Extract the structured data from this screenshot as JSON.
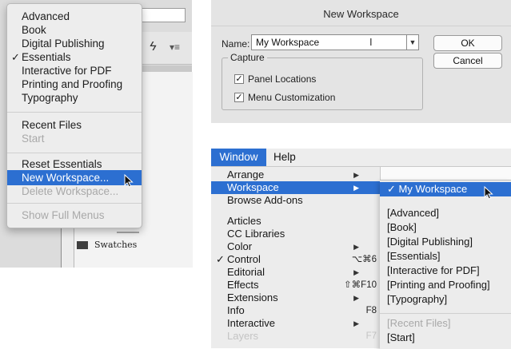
{
  "workspace_menu": {
    "items": [
      {
        "label": "Advanced"
      },
      {
        "label": "Book"
      },
      {
        "label": "Digital Publishing"
      },
      {
        "label": "Essentials",
        "checked": true
      },
      {
        "label": "Interactive for PDF"
      },
      {
        "label": "Printing and Proofing"
      },
      {
        "label": "Typography"
      }
    ],
    "recent": {
      "label": "Recent Files"
    },
    "start": {
      "label": "Start",
      "disabled": true
    },
    "reset": {
      "label": "Reset Essentials"
    },
    "new_workspace": {
      "label": "New Workspace...",
      "highlighted": true
    },
    "delete_workspace": {
      "label": "Delete Workspace...",
      "disabled": true
    },
    "show_full_menus": {
      "label": "Show Full Menus",
      "disabled": true
    },
    "check_mark": "✓",
    "panel_label": "Swatches"
  },
  "dialog": {
    "title": "New Workspace",
    "name_label": "Name:",
    "name_value": "My Workspace",
    "capture_label": "Capture",
    "panel_locations": {
      "label": "Panel Locations",
      "checked": true
    },
    "menu_customization": {
      "label": "Menu Customization",
      "checked": true
    },
    "ok": "OK",
    "cancel": "Cancel"
  },
  "window_menu": {
    "menubar": {
      "window": "Window",
      "help": "Help"
    },
    "items": [
      {
        "label": "Arrange",
        "submenu": true
      },
      {
        "label": "Workspace",
        "submenu": true,
        "highlighted": true
      },
      {
        "label": "Browse Add-ons"
      },
      {
        "label": "Articles"
      },
      {
        "label": "CC Libraries"
      },
      {
        "label": "Color",
        "submenu": true
      },
      {
        "label": "Control",
        "checked": true,
        "shortcut": "⌥⌘6"
      },
      {
        "label": "Editorial",
        "submenu": true
      },
      {
        "label": "Effects",
        "shortcut": "⇧⌘F10"
      },
      {
        "label": "Extensions",
        "submenu": true
      },
      {
        "label": "Info",
        "shortcut": "F8"
      },
      {
        "label": "Interactive",
        "submenu": true
      },
      {
        "label": "Layers",
        "shortcut": "F7",
        "faded": true
      }
    ],
    "workspace_submenu": {
      "current": "✓ My Workspace",
      "workspaces": [
        "[Advanced]",
        "[Book]",
        "[Digital Publishing]",
        "[Essentials]",
        "[Interactive for PDF]",
        "[Printing and Proofing]",
        "[Typography]"
      ],
      "recent": "[Recent Files]",
      "start": "[Start]"
    }
  },
  "colors": {
    "highlight": "#2c6fd1",
    "menu_bg": "#ececec",
    "dialog_bg": "#e4e4e4"
  }
}
